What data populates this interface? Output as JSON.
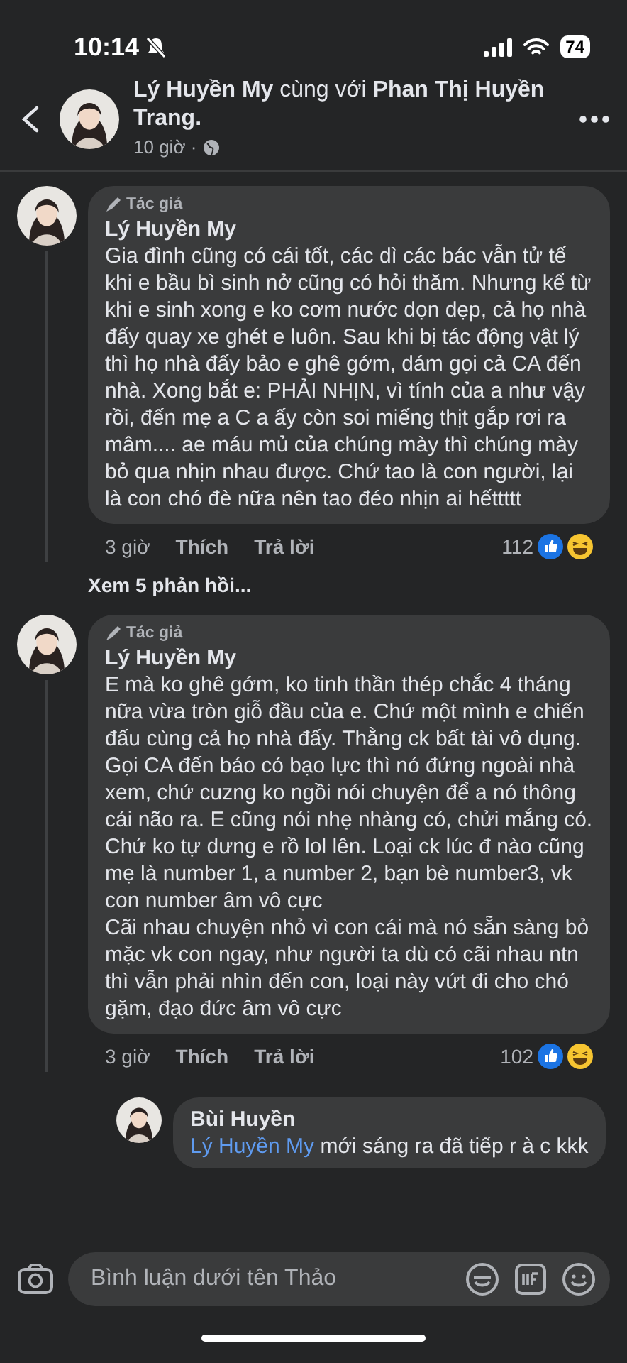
{
  "status_bar": {
    "time": "10:14",
    "battery": "74"
  },
  "post_header": {
    "title": "**Lý Huyền My** cùng với **Phan Thị Huyền Trang.**",
    "time": "10 giờ ·"
  },
  "comments": [
    {
      "badge": "Tác giả",
      "author": "Lý Huyền My",
      "text": "Gia đình cũng có cái tốt, các dì các bác vẫn tử tế khi e bầu bì sinh nở cũng có hỏi thăm. Nhưng kể từ khi e sinh xong e ko cơm nước dọn dẹp, cả họ nhà đấy quay xe ghét e luôn. Sau khi bị tác động vật lý thì họ nhà đấy bảo e ghê gớm, dám gọi cả CA đến nhà. Xong bắt e: PHẢI NHỊN, vì tính của a như vậy rồi, đến mẹ a C a ấy còn soi miếng thịt gắp rơi ra mâm.... ae máu mủ của chúng mày thì chúng mày bỏ qua nhịn nhau được. Chứ tao là con người, lại là con chó đè nữa nên tao đéo nhịn ai hếttttt",
      "time": "3 giờ",
      "like": "Thích",
      "reply": "Trả lời",
      "reactions": "112",
      "more_replies": "Xem 5 phản hồi..."
    },
    {
      "badge": "Tác giả",
      "author": "Lý Huyền My",
      "text": "E mà ko ghê gớm, ko tinh thần thép chắc 4 tháng nữa vừa tròn giỗ đầu của e. Chứ một mình e chiến đấu cùng cả họ nhà đấy. Thằng ck bất tài vô dụng. Gọi CA đến báo có bạo lực thì nó đứng ngoài nhà xem, chứ cuzng ko ngồi nói chuyện để a nó thông cái não ra. E cũng nói nhẹ nhàng có, chửi mắng có. Chứ ko tự dưng e rồ lol lên. Loại ck lúc đ nào cũng mẹ là number 1, a number 2, bạn bè number3, vk con number âm vô cực\nCãi nhau chuyện nhỏ vì con cái mà nó sẵn sàng bỏ mặc vk con ngay, như người ta dù có cãi nhau ntn thì vẫn phải nhìn đến con, loại này vứt đi cho chó gặm, đạo đức âm vô cực",
      "time": "3 giờ",
      "like": "Thích",
      "reply": "Trả lời",
      "reactions": "102",
      "replies": [
        {
          "author": "Bùi Huyền",
          "mention": "Lý Huyền My",
          "text": "mới sáng ra đã tiếp r à c kkk"
        }
      ]
    }
  ],
  "composer": {
    "placeholder": "Bình luận dưới tên Thảo"
  }
}
